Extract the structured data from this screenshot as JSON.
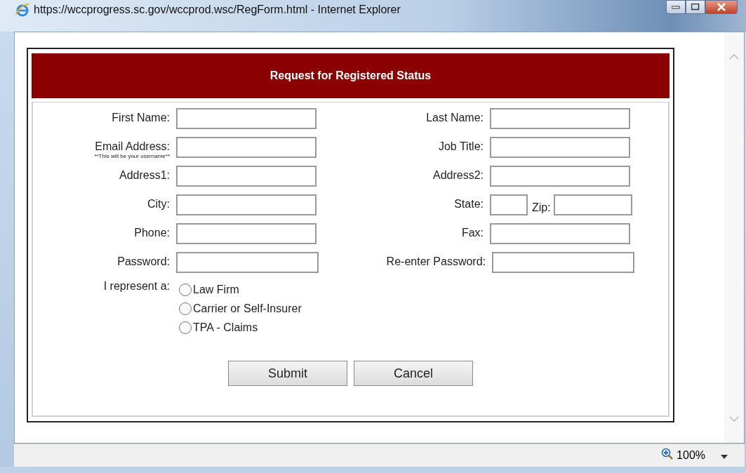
{
  "window": {
    "title": "https://wccprogress.sc.gov/wccprod.wsc/RegForm.html - Internet Explorer"
  },
  "form": {
    "heading": "Request for Registered Status",
    "rows": [
      {
        "left": {
          "kind": "text",
          "label": "First Name:"
        },
        "right": {
          "kind": "text",
          "label": "Last Name:"
        }
      },
      {
        "left": {
          "kind": "text",
          "label": "Email Address:",
          "hint": "**This will be your username**"
        },
        "right": {
          "kind": "text",
          "label": "Job Title:"
        }
      },
      {
        "left": {
          "kind": "text",
          "label": "Address1:"
        },
        "right": {
          "kind": "text",
          "label": "Address2:"
        }
      },
      {
        "left": {
          "kind": "text",
          "label": "City:"
        },
        "right": {
          "kind": "split",
          "label": "State:",
          "second_label": "Zip:"
        }
      },
      {
        "left": {
          "kind": "text",
          "label": "Phone:"
        },
        "right": {
          "kind": "text",
          "label": "Fax:"
        }
      },
      {
        "left": {
          "kind": "password",
          "label": "Password:"
        },
        "right": {
          "kind": "password",
          "label": "Re-enter Password:"
        }
      }
    ],
    "represent": {
      "label": "I represent a:",
      "options": [
        {
          "label": "Law Firm",
          "selected": false
        },
        {
          "label": "Carrier or Self-Insurer",
          "selected": false
        },
        {
          "label": "TPA - Claims",
          "selected": false
        }
      ]
    },
    "buttons": [
      "Submit",
      "Cancel"
    ]
  },
  "status_bar": {
    "zoom": "100%"
  }
}
